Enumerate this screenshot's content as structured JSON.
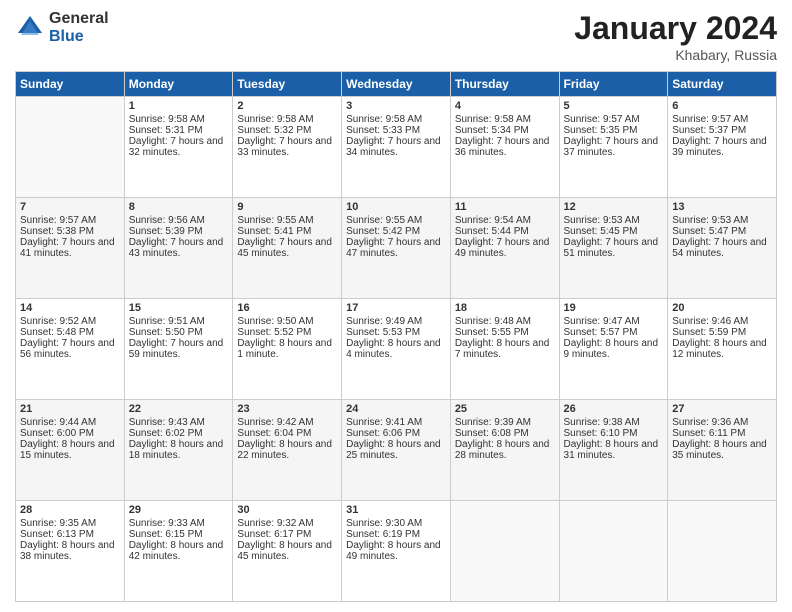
{
  "logo": {
    "general": "General",
    "blue": "Blue"
  },
  "title": "January 2024",
  "location": "Khabary, Russia",
  "weekdays": [
    "Sunday",
    "Monday",
    "Tuesday",
    "Wednesday",
    "Thursday",
    "Friday",
    "Saturday"
  ],
  "weeks": [
    [
      {
        "day": "",
        "sunrise": "",
        "sunset": "",
        "daylight": ""
      },
      {
        "day": "1",
        "sunrise": "Sunrise: 9:58 AM",
        "sunset": "Sunset: 5:31 PM",
        "daylight": "Daylight: 7 hours and 32 minutes."
      },
      {
        "day": "2",
        "sunrise": "Sunrise: 9:58 AM",
        "sunset": "Sunset: 5:32 PM",
        "daylight": "Daylight: 7 hours and 33 minutes."
      },
      {
        "day": "3",
        "sunrise": "Sunrise: 9:58 AM",
        "sunset": "Sunset: 5:33 PM",
        "daylight": "Daylight: 7 hours and 34 minutes."
      },
      {
        "day": "4",
        "sunrise": "Sunrise: 9:58 AM",
        "sunset": "Sunset: 5:34 PM",
        "daylight": "Daylight: 7 hours and 36 minutes."
      },
      {
        "day": "5",
        "sunrise": "Sunrise: 9:57 AM",
        "sunset": "Sunset: 5:35 PM",
        "daylight": "Daylight: 7 hours and 37 minutes."
      },
      {
        "day": "6",
        "sunrise": "Sunrise: 9:57 AM",
        "sunset": "Sunset: 5:37 PM",
        "daylight": "Daylight: 7 hours and 39 minutes."
      }
    ],
    [
      {
        "day": "7",
        "sunrise": "Sunrise: 9:57 AM",
        "sunset": "Sunset: 5:38 PM",
        "daylight": "Daylight: 7 hours and 41 minutes."
      },
      {
        "day": "8",
        "sunrise": "Sunrise: 9:56 AM",
        "sunset": "Sunset: 5:39 PM",
        "daylight": "Daylight: 7 hours and 43 minutes."
      },
      {
        "day": "9",
        "sunrise": "Sunrise: 9:55 AM",
        "sunset": "Sunset: 5:41 PM",
        "daylight": "Daylight: 7 hours and 45 minutes."
      },
      {
        "day": "10",
        "sunrise": "Sunrise: 9:55 AM",
        "sunset": "Sunset: 5:42 PM",
        "daylight": "Daylight: 7 hours and 47 minutes."
      },
      {
        "day": "11",
        "sunrise": "Sunrise: 9:54 AM",
        "sunset": "Sunset: 5:44 PM",
        "daylight": "Daylight: 7 hours and 49 minutes."
      },
      {
        "day": "12",
        "sunrise": "Sunrise: 9:53 AM",
        "sunset": "Sunset: 5:45 PM",
        "daylight": "Daylight: 7 hours and 51 minutes."
      },
      {
        "day": "13",
        "sunrise": "Sunrise: 9:53 AM",
        "sunset": "Sunset: 5:47 PM",
        "daylight": "Daylight: 7 hours and 54 minutes."
      }
    ],
    [
      {
        "day": "14",
        "sunrise": "Sunrise: 9:52 AM",
        "sunset": "Sunset: 5:48 PM",
        "daylight": "Daylight: 7 hours and 56 minutes."
      },
      {
        "day": "15",
        "sunrise": "Sunrise: 9:51 AM",
        "sunset": "Sunset: 5:50 PM",
        "daylight": "Daylight: 7 hours and 59 minutes."
      },
      {
        "day": "16",
        "sunrise": "Sunrise: 9:50 AM",
        "sunset": "Sunset: 5:52 PM",
        "daylight": "Daylight: 8 hours and 1 minute."
      },
      {
        "day": "17",
        "sunrise": "Sunrise: 9:49 AM",
        "sunset": "Sunset: 5:53 PM",
        "daylight": "Daylight: 8 hours and 4 minutes."
      },
      {
        "day": "18",
        "sunrise": "Sunrise: 9:48 AM",
        "sunset": "Sunset: 5:55 PM",
        "daylight": "Daylight: 8 hours and 7 minutes."
      },
      {
        "day": "19",
        "sunrise": "Sunrise: 9:47 AM",
        "sunset": "Sunset: 5:57 PM",
        "daylight": "Daylight: 8 hours and 9 minutes."
      },
      {
        "day": "20",
        "sunrise": "Sunrise: 9:46 AM",
        "sunset": "Sunset: 5:59 PM",
        "daylight": "Daylight: 8 hours and 12 minutes."
      }
    ],
    [
      {
        "day": "21",
        "sunrise": "Sunrise: 9:44 AM",
        "sunset": "Sunset: 6:00 PM",
        "daylight": "Daylight: 8 hours and 15 minutes."
      },
      {
        "day": "22",
        "sunrise": "Sunrise: 9:43 AM",
        "sunset": "Sunset: 6:02 PM",
        "daylight": "Daylight: 8 hours and 18 minutes."
      },
      {
        "day": "23",
        "sunrise": "Sunrise: 9:42 AM",
        "sunset": "Sunset: 6:04 PM",
        "daylight": "Daylight: 8 hours and 22 minutes."
      },
      {
        "day": "24",
        "sunrise": "Sunrise: 9:41 AM",
        "sunset": "Sunset: 6:06 PM",
        "daylight": "Daylight: 8 hours and 25 minutes."
      },
      {
        "day": "25",
        "sunrise": "Sunrise: 9:39 AM",
        "sunset": "Sunset: 6:08 PM",
        "daylight": "Daylight: 8 hours and 28 minutes."
      },
      {
        "day": "26",
        "sunrise": "Sunrise: 9:38 AM",
        "sunset": "Sunset: 6:10 PM",
        "daylight": "Daylight: 8 hours and 31 minutes."
      },
      {
        "day": "27",
        "sunrise": "Sunrise: 9:36 AM",
        "sunset": "Sunset: 6:11 PM",
        "daylight": "Daylight: 8 hours and 35 minutes."
      }
    ],
    [
      {
        "day": "28",
        "sunrise": "Sunrise: 9:35 AM",
        "sunset": "Sunset: 6:13 PM",
        "daylight": "Daylight: 8 hours and 38 minutes."
      },
      {
        "day": "29",
        "sunrise": "Sunrise: 9:33 AM",
        "sunset": "Sunset: 6:15 PM",
        "daylight": "Daylight: 8 hours and 42 minutes."
      },
      {
        "day": "30",
        "sunrise": "Sunrise: 9:32 AM",
        "sunset": "Sunset: 6:17 PM",
        "daylight": "Daylight: 8 hours and 45 minutes."
      },
      {
        "day": "31",
        "sunrise": "Sunrise: 9:30 AM",
        "sunset": "Sunset: 6:19 PM",
        "daylight": "Daylight: 8 hours and 49 minutes."
      },
      {
        "day": "",
        "sunrise": "",
        "sunset": "",
        "daylight": ""
      },
      {
        "day": "",
        "sunrise": "",
        "sunset": "",
        "daylight": ""
      },
      {
        "day": "",
        "sunrise": "",
        "sunset": "",
        "daylight": ""
      }
    ]
  ]
}
